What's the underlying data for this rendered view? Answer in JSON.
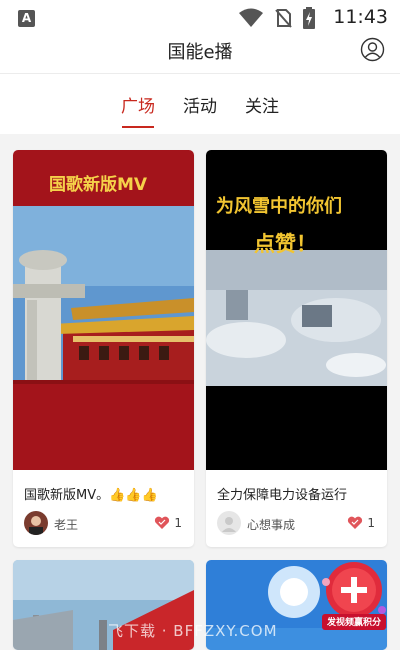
{
  "status_bar": {
    "app_badge": "A",
    "time": "11:43",
    "icons": [
      "wifi-icon",
      "no-sim-icon",
      "battery-charging-icon"
    ]
  },
  "header": {
    "title": "国能e播",
    "profile_icon": "user-circle-icon"
  },
  "tabs": [
    {
      "label": "广场",
      "active": true
    },
    {
      "label": "活动",
      "active": false
    },
    {
      "label": "关注",
      "active": false
    }
  ],
  "posts": [
    {
      "thumb_text": "国歌新版MV",
      "caption": "国歌新版MV。👍👍👍",
      "user": "老王",
      "likes": "1"
    },
    {
      "thumb_text_line1": "为风雪中的你们",
      "thumb_text_line2": "点赞！",
      "caption": "全力保障电力设备运行",
      "user": "心想事成",
      "likes": "1"
    }
  ],
  "floating_button": {
    "label": "发视频赢积分"
  },
  "watermark": "飞下载 · BFFZXY.COM",
  "colors": {
    "accent": "#c8281e",
    "background": "#f3f3f3"
  }
}
